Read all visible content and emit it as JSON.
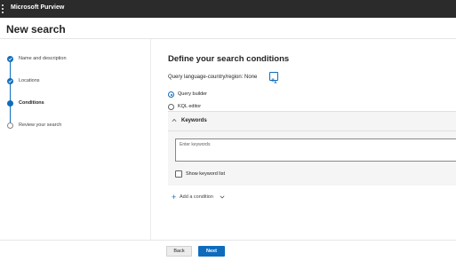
{
  "app": {
    "name": "Microsoft Purview"
  },
  "page": {
    "title": "New search"
  },
  "wizard": {
    "steps": [
      {
        "label": "Name and description",
        "state": "completed"
      },
      {
        "label": "Locations",
        "state": "completed"
      },
      {
        "label": "Conditions",
        "state": "current"
      },
      {
        "label": "Review your search",
        "state": "todo"
      }
    ]
  },
  "main": {
    "title": "Define your search conditions",
    "language_label": "Query language-country/region: None",
    "query_modes": [
      {
        "label": "Query builder",
        "selected": true
      },
      {
        "label": "KQL editor",
        "selected": false
      }
    ],
    "keywords": {
      "title": "Keywords",
      "placeholder": "Enter keywords",
      "show_list_label": "Show keyword list",
      "show_list_checked": false
    },
    "add_condition_label": "Add a condition"
  },
  "footer": {
    "back_label": "Back",
    "next_label": "Next"
  },
  "colors": {
    "accent": "#0f6cbd",
    "topbar": "#2b2b2b"
  }
}
